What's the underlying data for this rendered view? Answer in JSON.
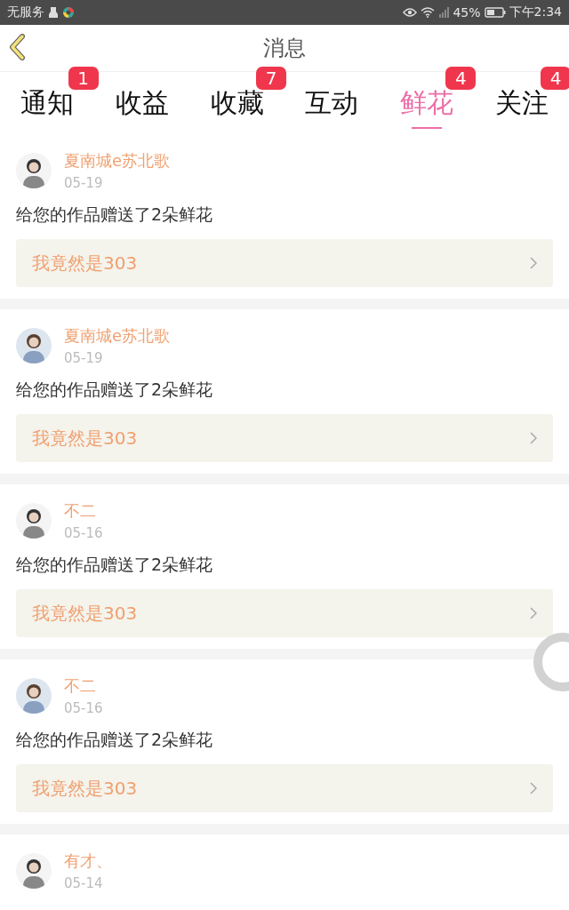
{
  "status_bar": {
    "carrier": "无服务",
    "battery": "45%",
    "time": "下午2:34"
  },
  "header": {
    "title": "消息"
  },
  "tabs": [
    {
      "label": "通知",
      "badge": "1",
      "selected": false
    },
    {
      "label": "收益",
      "selected": false
    },
    {
      "label": "收藏",
      "badge": "7",
      "selected": false
    },
    {
      "label": "互动",
      "selected": false
    },
    {
      "label": "鲜花",
      "badge": "4",
      "selected": true
    },
    {
      "label": "关注",
      "badge": "4",
      "selected": false
    }
  ],
  "messages": [
    {
      "name": "夏南城e苏北歌",
      "date": "05-19",
      "text": "给您的作品赠送了2朵鲜花",
      "work": "我竟然是303"
    },
    {
      "name": "夏南城e苏北歌",
      "date": "05-19",
      "text": "给您的作品赠送了2朵鲜花",
      "work": "我竟然是303"
    },
    {
      "name": "不二",
      "date": "05-16",
      "text": "给您的作品赠送了2朵鲜花",
      "work": "我竟然是303"
    },
    {
      "name": "不二",
      "date": "05-16",
      "text": "给您的作品赠送了2朵鲜花",
      "work": "我竟然是303"
    },
    {
      "name": "有才、",
      "date": "05-14"
    }
  ]
}
